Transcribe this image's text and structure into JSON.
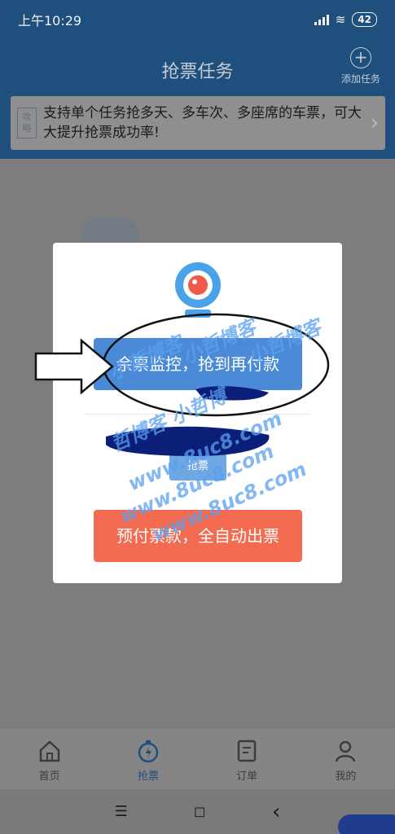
{
  "status_bar": {
    "time": "上午10:29",
    "battery": "42"
  },
  "header": {
    "title": "抢票任务",
    "add_task_label": "添加任务",
    "add_symbol": "+"
  },
  "tip": {
    "badge": "攻\n略",
    "text": "支持单个任务抢多天、多车次、多座席的车票，可大大提升抢票成功率!",
    "arrow": "›"
  },
  "modal": {
    "monitor_button": "余票监控，抢到再付款",
    "grab_button": "抢票",
    "prepay_button": "预付票款，全自动出票"
  },
  "watermarks": [
    "小哲博客",
    "小哲博客",
    "小哲博客",
    "哲博客 小哲博",
    "www.8uc8.com",
    "www.8uc8.com",
    "www.8uc8.com"
  ],
  "tabbar": {
    "items": [
      {
        "label": "首页",
        "icon": "home-icon"
      },
      {
        "label": "抢票",
        "icon": "stopwatch-icon"
      },
      {
        "label": "订单",
        "icon": "order-icon"
      },
      {
        "label": "我的",
        "icon": "person-icon"
      }
    ],
    "active_index": 1
  },
  "navbar": {
    "menu": "☰",
    "home": "◻",
    "back": "‹"
  },
  "colors": {
    "header_blue": "#1f4f7d",
    "monitor_button": "#4b8ad6",
    "prepay_button": "#f36c51",
    "overlay_gray": "#7d7d7d"
  }
}
